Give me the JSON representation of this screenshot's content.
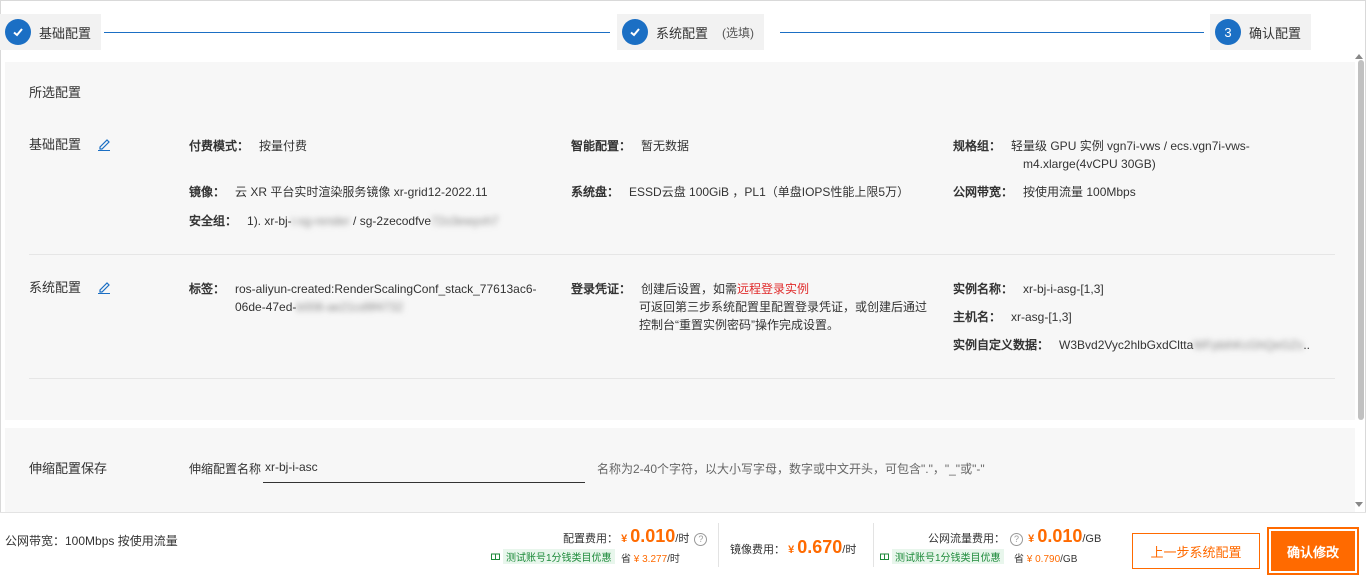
{
  "steps": [
    {
      "label": "基础配置",
      "state": "done"
    },
    {
      "label": "系统配置",
      "optional": "(选填)",
      "state": "done"
    },
    {
      "number": "3",
      "label": "确认配置",
      "state": "current"
    }
  ],
  "summary": {
    "title": "所选配置",
    "basic": {
      "title": "基础配置",
      "payment": {
        "k": "付费模式：",
        "v": "按量付费"
      },
      "smart": {
        "k": "智能配置：",
        "v": "暂无数据"
      },
      "spec": {
        "k": "规格组：",
        "v1": "轻量级 GPU 实例 vgn7i-vws / ecs.vgn7i-vws-",
        "v2": "m4.xlarge(4vCPU 30GB)"
      },
      "image": {
        "k": "镜像：",
        "v": "云 XR 平台实时渲染服务镜像 xr-grid12-2022.11"
      },
      "disk": {
        "k": "系统盘：",
        "v": "ESSD云盘 100GiB ，PL1（单盘IOPS性能上限5万）"
      },
      "bandwidth": {
        "k": "公网带宽：",
        "v": "按使用流量 100Mbps"
      },
      "sg": {
        "k": "安全组：",
        "v_a": "1). xr-bj-",
        "v_b": "i-sg-render",
        "v_c": " / sg-2zecodfve",
        "v_d": "72o3ewyvh7"
      }
    },
    "system": {
      "title": "系统配置",
      "tags": {
        "k": "标签：",
        "v1": "ros-aliyun-created:RenderScalingConf_stack_77613ac6-",
        "v2a": "06de-47ed-",
        "v2b": "b008-ae21cd9f4732"
      },
      "login": {
        "k": "登录凭证：",
        "v1a": "创建后设置，如需",
        "v1b": "远程登录实例",
        "v2": "可返回第三步系统配置里配置登录凭证，或创建后通过",
        "v3": "控制台“重置实例密码”操作完成设置。"
      },
      "instname": {
        "k": "实例名称：",
        "v": "xr-bj-i-asg-[1,3]"
      },
      "hostname": {
        "k": "主机名：",
        "v": "xr-asg-[1,3]"
      },
      "userdata": {
        "k": "实例自定义数据：",
        "va": "W3Bvd2Vyc2hlbGxdCltta",
        "vb": "WFpbihKcGhQeGZs",
        "vc": ".."
      }
    }
  },
  "save": {
    "title": "伸缩配置保存",
    "name_label": "伸缩配置名称",
    "name_value": "xr-bj-i-asc",
    "hint": "名称为2-40个字符，以大小写字母，数字或中文开头，可包含\".\"，\"_\"或\"-\""
  },
  "footer": {
    "bandwidth": "公网带宽：100Mbps 按使用流量",
    "config_fee": {
      "label": "配置费用：",
      "currency": "¥",
      "value": "0.010",
      "unit": "/时",
      "promo": "测试账号1分钱类目优惠",
      "save_label": "省",
      "save_value": "¥ 3.277",
      "save_unit": "/时"
    },
    "image_fee": {
      "label": "镜像费用：",
      "currency": "¥",
      "value": "0.670",
      "unit": "/时"
    },
    "traffic_fee": {
      "label": "公网流量费用：",
      "currency": "¥",
      "value": "0.010",
      "unit": "/GB",
      "promo": "测试账号1分钱类目优惠",
      "save_label": "省",
      "save_value": "¥ 0.790",
      "save_unit": "/GB"
    },
    "prev_button": "上一步系统配置",
    "confirm_button": "确认修改"
  },
  "colors": {
    "accent": "#1b6fc4",
    "orange": "#ff6a00",
    "red_link": "#e02b2b",
    "promo_green": "#1d8a3a"
  }
}
